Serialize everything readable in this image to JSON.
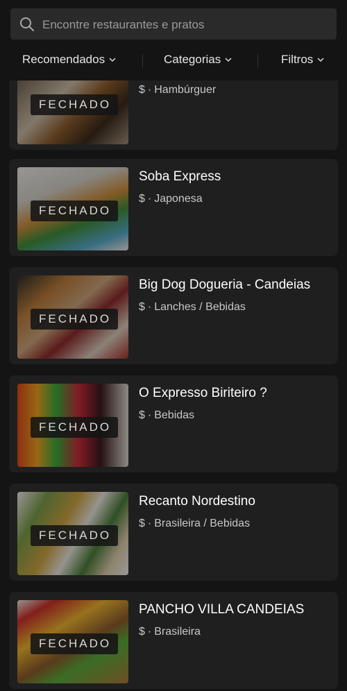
{
  "search": {
    "placeholder": "Encontre restaurantes e pratos"
  },
  "filters": {
    "recommended": "Recomendados",
    "categories": "Categorias",
    "filters": "Filtros"
  },
  "restaurants": [
    {
      "name": "",
      "price": "$",
      "categories": "Hambúrguer",
      "status": "FECHADO",
      "image": "burger-photo"
    },
    {
      "name": "Soba Express",
      "price": "$",
      "categories": "Japonesa",
      "status": "FECHADO",
      "image": "soba-photo"
    },
    {
      "name": "Big Dog Dogueria - Candeias",
      "price": "$",
      "categories": "Lanches / Bebidas",
      "status": "FECHADO",
      "image": "hotdog-photo"
    },
    {
      "name": "O Expresso Biriteiro ?",
      "price": "$",
      "categories": "Bebidas",
      "status": "FECHADO",
      "image": "drinks-photo"
    },
    {
      "name": "Recanto Nordestino",
      "price": "$",
      "categories": "Brasileira / Bebidas",
      "status": "FECHADO",
      "image": "northeast-food-photo"
    },
    {
      "name": "PANCHO VILLA CANDEIAS",
      "price": "$",
      "categories": "Brasileira",
      "status": "FECHADO",
      "image": "tacos-photo"
    }
  ]
}
